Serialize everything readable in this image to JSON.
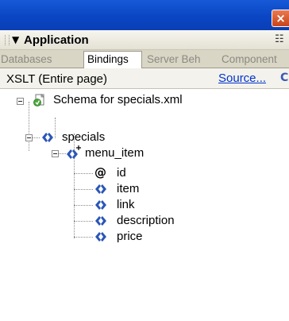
{
  "window": {
    "close_label": "×"
  },
  "panel": {
    "arrow": "▼",
    "title": "Application",
    "menu_glyph": "☷"
  },
  "tabs": [
    {
      "label": "Databases"
    },
    {
      "label": "Bindings"
    },
    {
      "label": "Server Beh"
    },
    {
      "label": "Component"
    }
  ],
  "toolbar": {
    "source_label": "XSLT (Entire page)",
    "source_link": "Source...",
    "refresh_glyph": "C"
  },
  "tree": {
    "root": {
      "label": "Schema for specials.xml",
      "icon": "xml-schema-icon"
    },
    "specials": {
      "label": "specials",
      "icon": "element-icon"
    },
    "menu_item": {
      "label": "menu_item",
      "icon": "repeating-element-icon"
    },
    "children": [
      {
        "label": "id",
        "icon": "attribute-icon"
      },
      {
        "label": "item",
        "icon": "element-icon"
      },
      {
        "label": "link",
        "icon": "element-icon"
      },
      {
        "label": "description",
        "icon": "element-icon"
      },
      {
        "label": "price",
        "icon": "element-icon"
      }
    ]
  },
  "colors": {
    "title_bar": "#0a46c4",
    "close_button": "#d9541e",
    "link": "#0033cc",
    "element_icon": "#2a56b8"
  }
}
